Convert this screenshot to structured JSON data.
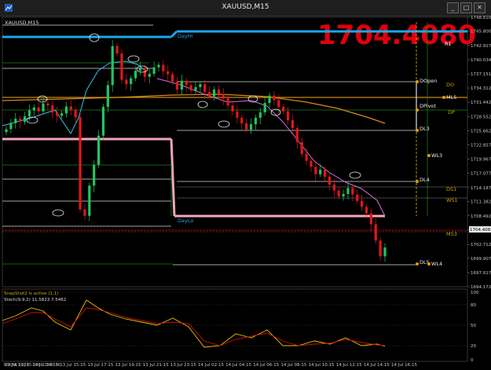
{
  "window": {
    "title": "XAUUSD,M15",
    "minimize": "_",
    "maximize": "□",
    "close": "✕"
  },
  "symbol_label": "XAUUSD,M15",
  "big_price": "1704.4080",
  "price_axis": [
    "1748.610",
    "1745.800",
    "1742.917",
    "1740.034",
    "1737.151",
    "1734.312",
    "1731.442",
    "1728.552",
    "1725.662",
    "1722.857",
    "1719.967",
    "1717.077",
    "1714.187",
    "1711.382",
    "1708.492",
    "1705.602",
    "1702.712",
    "1699.907",
    "1697.017",
    "1694.172"
  ],
  "current_price": "1704.408",
  "level_labels": {
    "dayhi": "DayHi",
    "daylo": "DayLo",
    "r1": "R1",
    "dopen": "DOpen",
    "do": "DO",
    "ml5": "ML5",
    "dpivot": "DPivot",
    "dp": "DP",
    "dl3": "DL3",
    "wl3": "WL3",
    "dl4": "DL4",
    "ds1": "DS1",
    "ws1": "WS1",
    "ms3": "MS3",
    "dl5": "DL5",
    "wl4": "WL4"
  },
  "indicator": {
    "snapshot_text": "SnapShot2 is active (1,1)",
    "stoch_label": "Stoch(9,9,2) 11.5823 7.5462",
    "bottom_label": "RSI(FA,1,1) 65.5460 23.8126",
    "scale": [
      "100",
      "80",
      "50",
      "20",
      "0"
    ],
    "colors": {
      "main": "#e8c400",
      "signal": "#d01010"
    }
  },
  "time_axis": [
    "13 Jul 2022",
    "13 Jul 14:15",
    "13 Jul 15:15",
    "13 Jul 17:15",
    "13 Jul 19:15",
    "13 Jul 21:15",
    "13 Jul 23:15",
    "14 Jul 02:15",
    "14 Jul 04:15",
    "14 Jul 06:15",
    "14 Jul 08:15",
    "14 Jul 10:15",
    "14 Jul 12:15",
    "14 Jul 14:15",
    "14 Jul 16:15"
  ],
  "chart_data": {
    "type": "candlestick",
    "symbol": "XAUUSD",
    "timeframe": "M15",
    "ylim": [
      1694.17,
      1748.61
    ],
    "current_price": 1704.408,
    "candles_close": [
      1726.0,
      1727.2,
      1728.1,
      1727.5,
      1728.6,
      1729.8,
      1730.4,
      1729.6,
      1731.2,
      1730.8,
      1729.4,
      1728.7,
      1729.2,
      1730.6,
      1729.9,
      1728.4,
      1709.8,
      1708.5,
      1714.6,
      1718.8,
      1724.7,
      1730.5,
      1734.9,
      1742.8,
      1741.3,
      1736.0,
      1735.1,
      1736.3,
      1737.8,
      1738.4,
      1736.6,
      1737.2,
      1738.5,
      1739.0,
      1737.7,
      1737.1,
      1735.6,
      1734.0,
      1735.8,
      1734.9,
      1733.8,
      1734.5,
      1735.1,
      1733.5,
      1732.6,
      1734.0,
      1733.1,
      1732.2,
      1730.8,
      1729.6,
      1728.3,
      1727.2,
      1725.9,
      1727.0,
      1728.3,
      1729.4,
      1731.3,
      1732.8,
      1731.9,
      1730.5,
      1729.6,
      1727.8,
      1726.2,
      1723.4,
      1721.0,
      1719.6,
      1718.4,
      1716.9,
      1717.8,
      1716.4,
      1714.8,
      1713.6,
      1712.4,
      1712.9,
      1714.1,
      1712.8,
      1711.5,
      1710.3,
      1709.0,
      1706.8,
      1703.5,
      1700.3,
      1702.1
    ]
  }
}
